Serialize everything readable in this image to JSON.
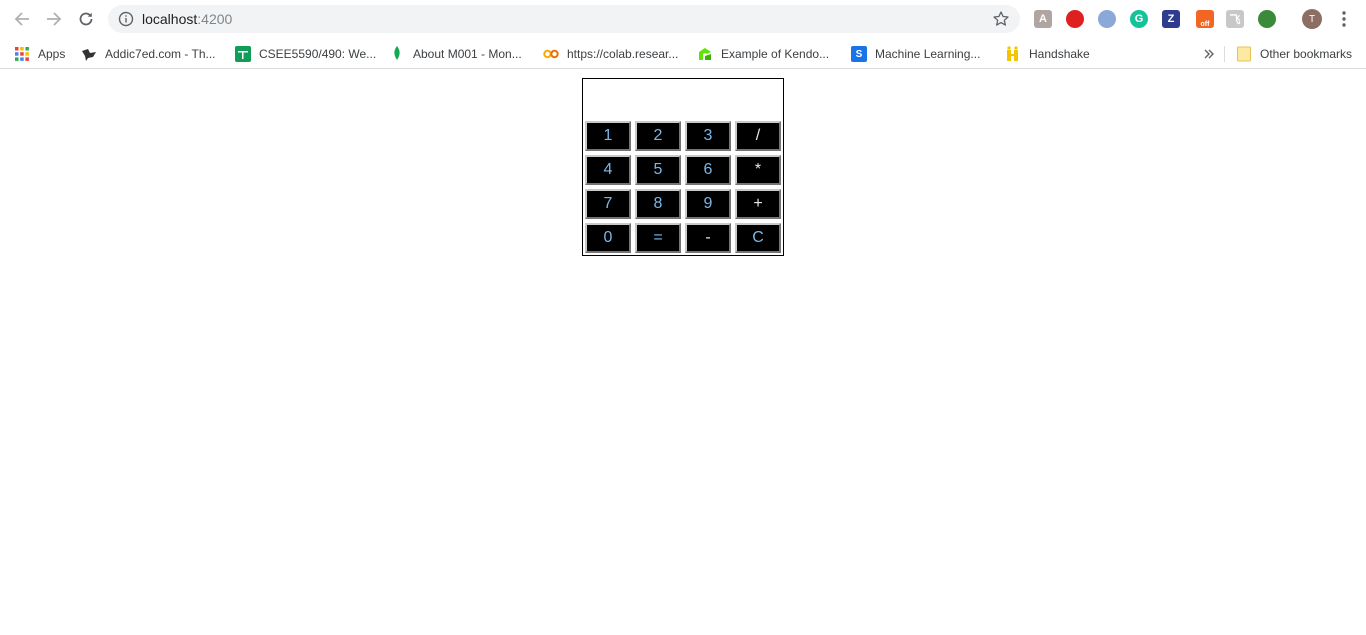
{
  "browser": {
    "url_host": "localhost",
    "url_port": ":4200",
    "profile_initial": "T",
    "extensions": [
      {
        "name": "pdf-extension-icon",
        "color": "#b0a5a0",
        "glyph": "A"
      },
      {
        "name": "ad-block-icon",
        "color": "#e02020",
        "glyph": ""
      },
      {
        "name": "cookie-extension-icon",
        "color": "#8aa8d8",
        "glyph": ""
      },
      {
        "name": "grammarly-icon",
        "color": "#15c39a",
        "glyph": "G"
      },
      {
        "name": "zotero-icon",
        "color": "#2e3b8f",
        "glyph": "Z"
      },
      {
        "name": "tab-extension-icon",
        "color": "#f26522",
        "glyph": "off"
      },
      {
        "name": "translate-extension-icon",
        "color": "#c8c8c8",
        "glyph": "飞"
      },
      {
        "name": "download-extension-icon",
        "color": "#3a8a3a",
        "glyph": ""
      }
    ]
  },
  "bookmarks": [
    {
      "label": "Apps",
      "icon": "apps-grid-icon",
      "color": "#e0e0e0"
    },
    {
      "label": "Addic7ed.com - Th...",
      "icon": "addic7ed-icon",
      "color": "#333333"
    },
    {
      "label": "CSEE5590/490: We...",
      "icon": "sheets-icon",
      "color": "#0f9d58"
    },
    {
      "label": "About M001 - Mon...",
      "icon": "mongodb-leaf-icon",
      "color": "#13aa52"
    },
    {
      "label": "https://colab.resear...",
      "icon": "colab-icon",
      "color": "#f9ab00"
    },
    {
      "label": "Example of Kendo...",
      "icon": "kendo-icon",
      "color": "#5ce500"
    },
    {
      "label": "Machine Learning...",
      "icon": "s-bookmark-icon",
      "color": "#1a73e8"
    },
    {
      "label": "Handshake",
      "icon": "handshake-icon",
      "color": "#f2c500"
    }
  ],
  "other_bookmarks": "Other bookmarks",
  "calculator": {
    "display_value": "",
    "keys": [
      [
        "1",
        "2",
        "3",
        "/"
      ],
      [
        "4",
        "5",
        "6",
        "*"
      ],
      [
        "7",
        "8",
        "9",
        "+"
      ],
      [
        "0",
        "=",
        "-",
        "C"
      ]
    ]
  }
}
